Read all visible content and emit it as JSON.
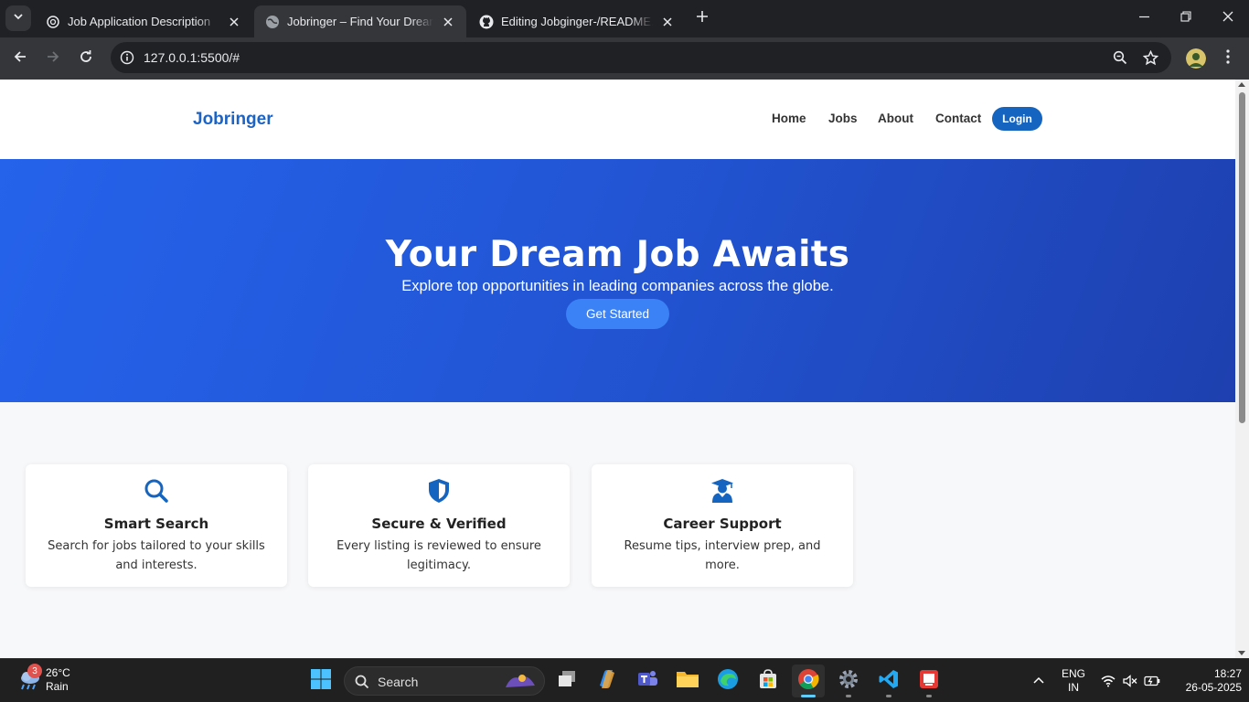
{
  "browser": {
    "tabs": [
      {
        "title": "Job Application Description",
        "active": false
      },
      {
        "title": "Jobringer – Find Your Dream Job",
        "active": true
      },
      {
        "title": "Editing Jobginger-/README.md",
        "active": false
      }
    ],
    "url": "127.0.0.1:5500/#"
  },
  "site": {
    "brand": "Jobringer",
    "nav": [
      "Home",
      "Jobs",
      "About",
      "Contact"
    ],
    "login_label": "Login",
    "hero": {
      "title": "Your Dream Job Awaits",
      "subtitle": "Explore top opportunities in leading companies across the globe.",
      "cta": "Get Started"
    },
    "features": [
      {
        "icon": "search-icon",
        "title": "Smart Search",
        "text": "Search for jobs tailored to your skills and interests."
      },
      {
        "icon": "shield-icon",
        "title": "Secure & Verified",
        "text": "Every listing is reviewed to ensure legitimacy."
      },
      {
        "icon": "graduate-icon",
        "title": "Career Support",
        "text": "Resume tips, interview prep, and more."
      }
    ],
    "colors": {
      "accent": "#1565c0",
      "hero_start": "#2563eb",
      "hero_end": "#1e40af",
      "cta": "#3b82f6"
    }
  },
  "taskbar": {
    "weather": {
      "temp": "26°C",
      "condition": "Rain",
      "badge": "3"
    },
    "search_label": "Search",
    "language": {
      "line1": "ENG",
      "line2": "IN"
    },
    "clock": {
      "time": "18:27",
      "date": "26-05-2025"
    }
  }
}
